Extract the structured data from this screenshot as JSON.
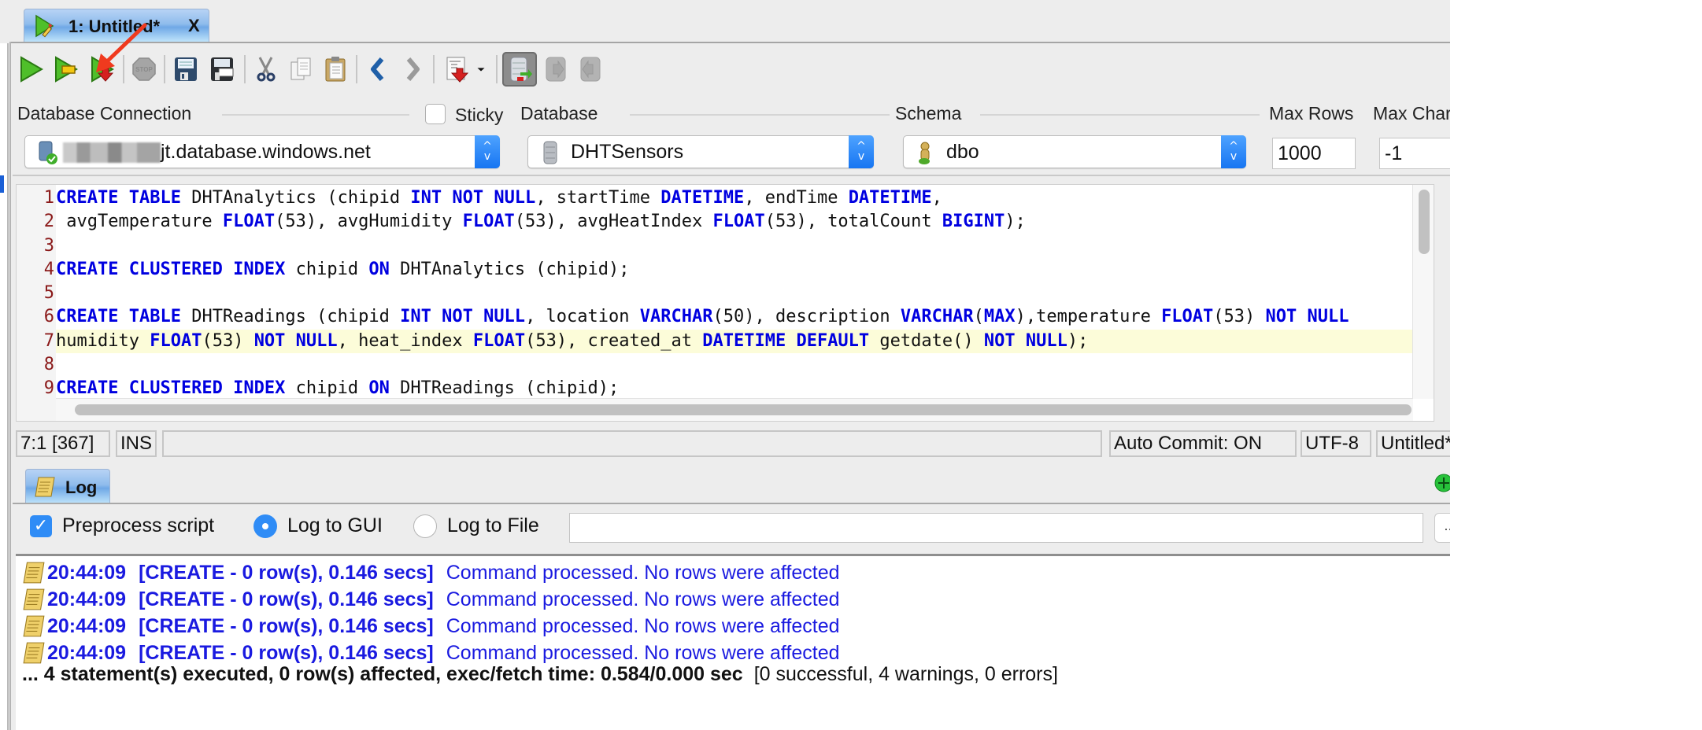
{
  "document_tab": {
    "label": "1: Untitled*",
    "close_label": "X"
  },
  "toolbar": {
    "buttons": [
      {
        "name": "execute",
        "icon": "play-green-icon"
      },
      {
        "name": "execute-current",
        "icon": "play-partial-icon"
      },
      {
        "name": "execute-explain",
        "icon": "play-download-icon"
      },
      {
        "name": "stop",
        "icon": "stop-icon",
        "label": "STOP"
      },
      {
        "name": "save",
        "icon": "save-icon"
      },
      {
        "name": "save-as",
        "icon": "save-as-icon"
      },
      {
        "name": "cut",
        "icon": "scissors-icon"
      },
      {
        "name": "copy",
        "icon": "copy-icon"
      },
      {
        "name": "paste",
        "icon": "clipboard-icon"
      },
      {
        "name": "back",
        "icon": "chevron-left-icon"
      },
      {
        "name": "forward",
        "icon": "chevron-right-icon"
      },
      {
        "name": "export",
        "icon": "export-doc-icon"
      },
      {
        "name": "export-dropdown",
        "icon": "caret-down-icon"
      },
      {
        "name": "auto-commit-toggle",
        "icon": "db-refresh-icon"
      },
      {
        "name": "commit",
        "icon": "db-commit-icon"
      },
      {
        "name": "rollback",
        "icon": "db-rollback-icon"
      }
    ]
  },
  "connection": {
    "database_connection_label": "Database Connection",
    "sticky_label": "Sticky",
    "sticky_checked": false,
    "database_label": "Database",
    "schema_label": "Schema",
    "max_rows_label": "Max Rows",
    "max_chars_label": "Max Chars",
    "connection_value": "jt.database.windows.net",
    "database_value": "DHTSensors",
    "schema_value": "dbo",
    "max_rows_value": "1000",
    "max_chars_value": "-1"
  },
  "editor": {
    "lines": [
      {
        "n": "1",
        "tokens": [
          [
            "kw",
            "CREATE TABLE"
          ],
          [
            "t",
            " DHTAnalytics (chipid "
          ],
          [
            "kw",
            "INT NOT NULL"
          ],
          [
            "t",
            ", startTime "
          ],
          [
            "kw",
            "DATETIME"
          ],
          [
            "t",
            ", endTime "
          ],
          [
            "kw",
            "DATETIME"
          ],
          [
            "t",
            ","
          ]
        ]
      },
      {
        "n": "2",
        "tokens": [
          [
            "t",
            " avgTemperature "
          ],
          [
            "kw",
            "FLOAT"
          ],
          [
            "t",
            "(53), avgHumidity "
          ],
          [
            "kw",
            "FLOAT"
          ],
          [
            "t",
            "(53), avgHeatIndex "
          ],
          [
            "kw",
            "FLOAT"
          ],
          [
            "t",
            "(53), totalCount "
          ],
          [
            "kw",
            "BIGINT"
          ],
          [
            "t",
            ");"
          ]
        ]
      },
      {
        "n": "3",
        "tokens": []
      },
      {
        "n": "4",
        "tokens": [
          [
            "kw",
            "CREATE CLUSTERED INDEX"
          ],
          [
            "t",
            " chipid "
          ],
          [
            "kw",
            "ON"
          ],
          [
            "t",
            " DHTAnalytics (chipid);"
          ]
        ]
      },
      {
        "n": "5",
        "tokens": []
      },
      {
        "n": "6",
        "tokens": [
          [
            "kw",
            "CREATE TABLE"
          ],
          [
            "t",
            " DHTReadings (chipid "
          ],
          [
            "kw",
            "INT NOT NULL"
          ],
          [
            "t",
            ", location "
          ],
          [
            "kw",
            "VARCHAR"
          ],
          [
            "t",
            "(50), description "
          ],
          [
            "kw",
            "VARCHAR"
          ],
          [
            "t",
            "("
          ],
          [
            "kw",
            "MAX"
          ],
          [
            "t",
            "),temperature "
          ],
          [
            "kw",
            "FLOAT"
          ],
          [
            "t",
            "(53) "
          ],
          [
            "kw",
            "NOT NULL"
          ]
        ]
      },
      {
        "n": "7",
        "current": true,
        "tokens": [
          [
            "t",
            "humidity "
          ],
          [
            "kw",
            "FLOAT"
          ],
          [
            "t",
            "(53) "
          ],
          [
            "kw",
            "NOT NULL"
          ],
          [
            "t",
            ", heat_index "
          ],
          [
            "kw",
            "FLOAT"
          ],
          [
            "t",
            "(53), created_at "
          ],
          [
            "kw",
            "DATETIME DEFAULT"
          ],
          [
            "t",
            " getdate() "
          ],
          [
            "kw",
            "NOT NULL"
          ],
          [
            "t",
            ");"
          ]
        ]
      },
      {
        "n": "8",
        "tokens": []
      },
      {
        "n": "9",
        "tokens": [
          [
            "kw",
            "CREATE CLUSTERED INDEX"
          ],
          [
            "t",
            " chipid "
          ],
          [
            "kw",
            "ON"
          ],
          [
            "t",
            " DHTReadings (chipid);"
          ]
        ]
      }
    ]
  },
  "status_bar": {
    "position": "7:1 [367]",
    "mode": "INS",
    "auto_commit": "Auto Commit: ON",
    "encoding": "UTF-8",
    "file": "Untitled*"
  },
  "log": {
    "tab_label": "Log",
    "preprocess_label": "Preprocess script",
    "preprocess_checked": true,
    "log_to_gui_label": "Log to GUI",
    "log_to_file_label": "Log to File",
    "selected_target": "gui",
    "file_path": "",
    "browse_label": "...",
    "entries": [
      {
        "time": "20:44:09",
        "meta": "[CREATE - 0 row(s), 0.146 secs]",
        "message": "Command processed. No rows were affected"
      },
      {
        "time": "20:44:09",
        "meta": "[CREATE - 0 row(s), 0.146 secs]",
        "message": "Command processed. No rows were affected"
      },
      {
        "time": "20:44:09",
        "meta": "[CREATE - 0 row(s), 0.146 secs]",
        "message": "Command processed. No rows were affected"
      },
      {
        "time": "20:44:09",
        "meta": "[CREATE - 0 row(s), 0.146 secs]",
        "message": "Command processed. No rows were affected"
      }
    ],
    "summary": "... 4 statement(s) executed, 0 row(s) affected, exec/fetch time: 0.584/0.000 sec",
    "summary_counts": "[0 successful, 4 warnings, 0 errors]"
  },
  "colors": {
    "keyword": "#0000e0",
    "line_number": "#8b1a1a",
    "current_line": "#fcfcd9",
    "log_text": "#1a1ae0",
    "accent_blue": "#2f8cf6",
    "annotation_arrow": "#f03a1e"
  }
}
